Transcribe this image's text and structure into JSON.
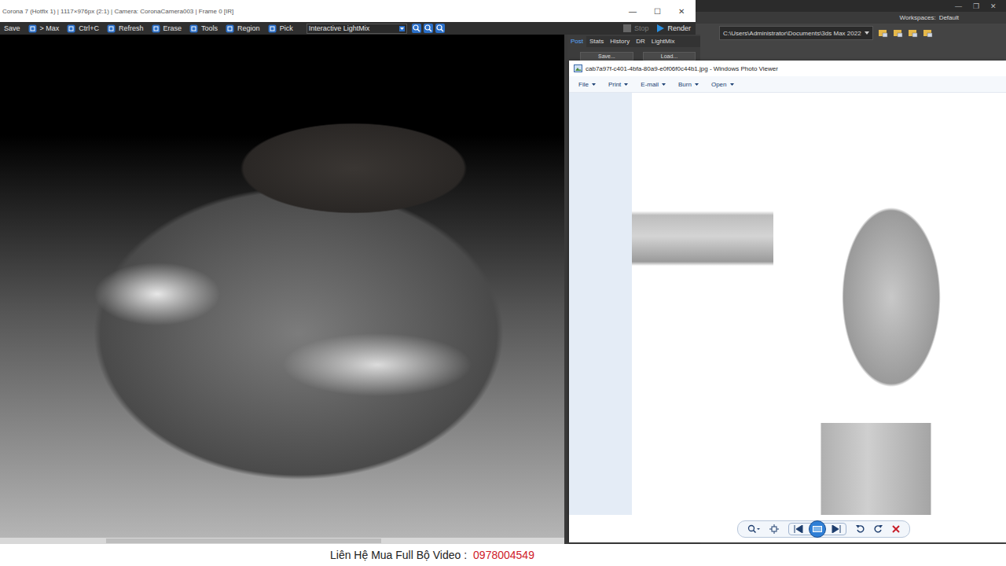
{
  "vfb": {
    "title": "Corona 7 (Hotfix 1) | 1117×976px (2:1) | Camera: CoronaCamera003 | Frame 0 [IR]",
    "controls": [
      "—",
      "☐",
      "✕"
    ],
    "toolbar": [
      {
        "label": "Save",
        "kind": "text"
      },
      {
        "label": "> Max",
        "kind": "icon"
      },
      {
        "label": "Ctrl+C",
        "kind": "icon"
      },
      {
        "label": "Refresh",
        "kind": "icon"
      },
      {
        "label": "Erase",
        "kind": "icon"
      },
      {
        "label": "Tools",
        "kind": "icon"
      },
      {
        "label": "Region",
        "kind": "icon"
      },
      {
        "label": "Pick",
        "kind": "icon"
      }
    ],
    "lightmix": "Interactive LightMix",
    "stop": {
      "label": "Stop",
      "disabled": true
    },
    "render": {
      "label": "Render",
      "disabled": false
    },
    "tabs": [
      {
        "label": "Post",
        "selected": true
      },
      {
        "label": "Stats",
        "selected": false
      },
      {
        "label": "History",
        "selected": false
      },
      {
        "label": "DR",
        "selected": false
      },
      {
        "label": "LightMix",
        "selected": false
      }
    ],
    "buttons": [
      "Save...",
      "Load..."
    ]
  },
  "max": {
    "workspaces_label": "Workspaces:",
    "workspace": "Default",
    "path": "C:\\Users\\Administrator\\Documents\\3ds Max 2022",
    "controls": [
      "—",
      "❐",
      "✕"
    ]
  },
  "viewer": {
    "title": "cab7a97f-c401-4bfa-80a9-e0f06f0c44b1.jpg - Windows Photo Viewer",
    "menu": [
      {
        "label": "File"
      },
      {
        "label": "Print"
      },
      {
        "label": "E-mail"
      },
      {
        "label": "Burn"
      },
      {
        "label": "Open"
      }
    ]
  },
  "banner": {
    "label": "Liên Hệ Mua Full Bộ Video :",
    "phone": "0978004549"
  }
}
